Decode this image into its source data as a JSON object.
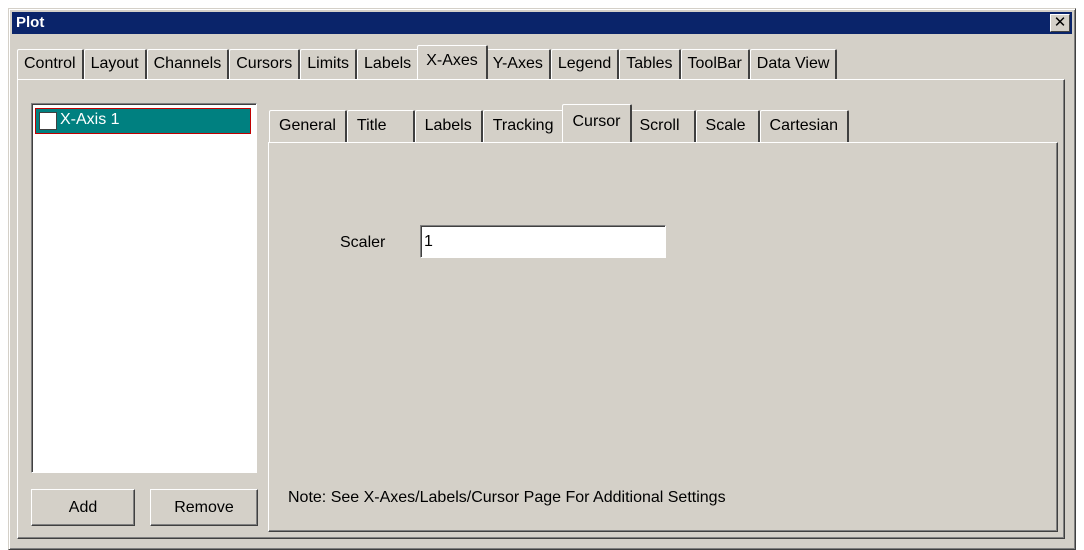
{
  "window": {
    "title": "Plot",
    "close_glyph": "✕"
  },
  "top_tabs": {
    "items": [
      "Control",
      "Layout",
      "Channels",
      "Cursors",
      "Limits",
      "Labels",
      "X-Axes",
      "Y-Axes",
      "Legend",
      "Tables",
      "ToolBar",
      "Data View"
    ],
    "selected": "X-Axes"
  },
  "axis_list": {
    "items": [
      {
        "label": "X-Axis 1",
        "checked": false,
        "selected": true
      }
    ]
  },
  "buttons": {
    "add_label": "Add",
    "remove_label": "Remove"
  },
  "inner_tabs": {
    "items": [
      "General",
      "Title",
      "Labels",
      "Tracking",
      "Cursor",
      "Scroll",
      "Scale",
      "Cartesian"
    ],
    "selected": "Cursor"
  },
  "cursor_page": {
    "scaler_label": "Scaler",
    "scaler_value": "1",
    "note": "Note: See X-Axes/Labels/Cursor Page For Additional Settings"
  },
  "colors": {
    "title_bar": "#0a246a",
    "dialog_bg": "#d4d0c8",
    "selection": "#008080"
  }
}
